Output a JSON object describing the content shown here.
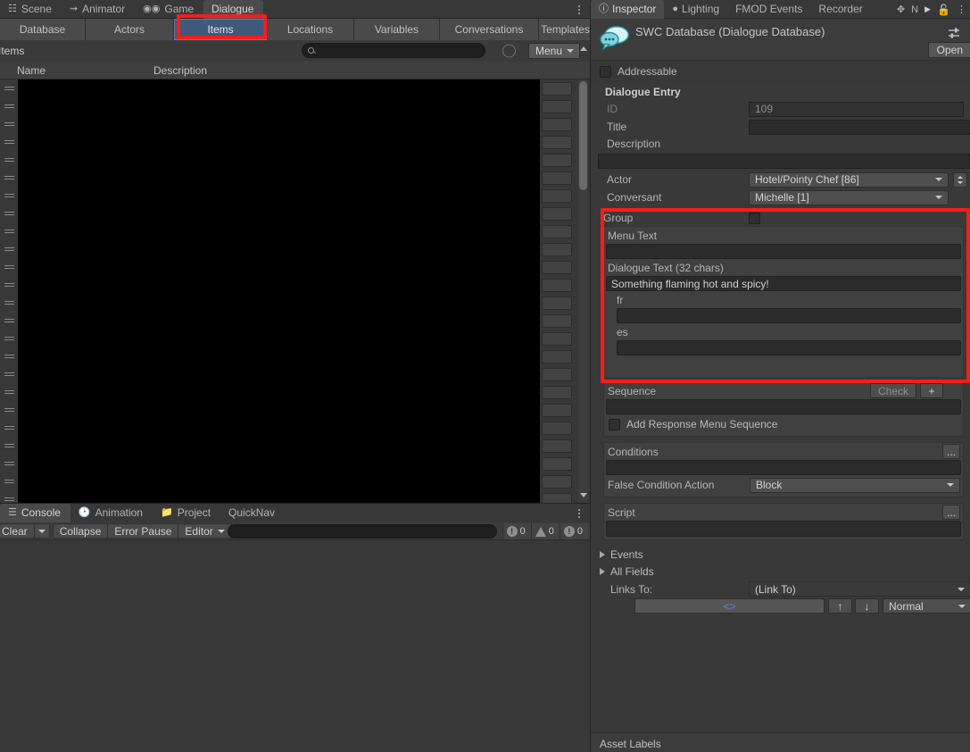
{
  "window_tabs": [
    {
      "label": "Scene",
      "icon": "grid-icon",
      "active": false
    },
    {
      "label": "Animator",
      "icon": "animator-icon",
      "active": false
    },
    {
      "label": "Game",
      "icon": "gamepad-icon",
      "active": false
    },
    {
      "label": "Dialogue",
      "icon": "",
      "active": true
    }
  ],
  "database_tabs": [
    {
      "label": "Database",
      "selected": false
    },
    {
      "label": "Actors",
      "selected": false
    },
    {
      "label": "Items",
      "selected": true
    },
    {
      "label": "Locations",
      "selected": false
    },
    {
      "label": "Variables",
      "selected": false
    },
    {
      "label": "Conversations",
      "selected": false
    },
    {
      "label": "Templates",
      "selected": false
    }
  ],
  "items_panel": {
    "title": "Items",
    "search_value": "",
    "search_placeholder": "",
    "menu_label": "Menu",
    "columns": [
      "Name",
      "Description"
    ],
    "row_count": 24
  },
  "console": {
    "tabs": [
      {
        "label": "Console",
        "icon": "console-icon",
        "active": true
      },
      {
        "label": "Animation",
        "icon": "clock-icon",
        "active": false
      },
      {
        "label": "Project",
        "icon": "folder-icon",
        "active": false
      },
      {
        "label": "QuickNav",
        "icon": "",
        "active": false
      }
    ],
    "clear_label": "Clear",
    "collapse_label": "Collapse",
    "error_pause_label": "Error Pause",
    "editor_label": "Editor",
    "search_value": "",
    "counters": [
      {
        "icon": "log-icon",
        "count": "0"
      },
      {
        "icon": "warning-icon",
        "count": "0"
      },
      {
        "icon": "error-icon",
        "count": "0"
      }
    ]
  },
  "inspector": {
    "tabs": [
      {
        "label": "Inspector",
        "icon": "info-icon",
        "active": true
      },
      {
        "label": "Lighting",
        "icon": "bulb-icon",
        "active": false
      },
      {
        "label": "FMOD Events",
        "icon": "",
        "active": false
      },
      {
        "label": "Recorder",
        "icon": "",
        "active": false
      }
    ],
    "header_icons": [
      "expand-icon",
      "navigation-icon",
      "play-icon",
      "lock-icon",
      "kebab-icon"
    ],
    "asset_title": "SWC Database (Dialogue Database)",
    "asset_icon": "dialogue-bubble-icon",
    "preset_icon": "preset-icon",
    "open_label": "Open",
    "addressable_label": "Addressable",
    "addressable_checked": false,
    "section_title": "Dialogue Entry",
    "fields": {
      "id_label": "ID",
      "id_value": "109",
      "title_label": "Title",
      "title_value": "",
      "description_label": "Description",
      "description_value": "",
      "actor_label": "Actor",
      "actor_value": "Hotel/Pointy Chef [86]",
      "conversant_label": "Conversant",
      "conversant_value": "Michelle [1]"
    },
    "group": {
      "group_label": "Group",
      "group_checked": false,
      "menu_text_label": "Menu Text",
      "menu_text_value": "",
      "dialogue_text_label": "Dialogue Text (32 chars)",
      "dialogue_text_value": "Something flaming hot and spicy!",
      "localizations": [
        {
          "lang": "fr",
          "value": ""
        },
        {
          "lang": "es",
          "value": ""
        }
      ]
    },
    "sequence": {
      "label": "Sequence",
      "check_label": "Check",
      "plus_label": "+",
      "value": "",
      "add_response_menu_label": "Add Response Menu Sequence",
      "add_response_menu_checked": false
    },
    "conditions": {
      "label": "Conditions",
      "ellipsis_label": "...",
      "value": "",
      "false_action_label": "False Condition Action",
      "false_action_value": "Block"
    },
    "script": {
      "label": "Script",
      "ellipsis_label": "...",
      "value": ""
    },
    "foldouts": [
      {
        "label": "Events"
      },
      {
        "label": "All Fields"
      }
    ],
    "links": {
      "label": "Links To:",
      "dropdown_value": "(Link To)",
      "link_glyph": "<>",
      "up_glyph": "↑",
      "down_glyph": "↓",
      "priority_value": "Normal"
    },
    "asset_labels": "Asset Labels"
  },
  "colors": {
    "selected_tab": "#40587a",
    "annotation_red": "#fb1b1b",
    "panel_bg": "#393939",
    "input_bg": "#2b2b2b",
    "link_blue": "#6f77e6"
  }
}
